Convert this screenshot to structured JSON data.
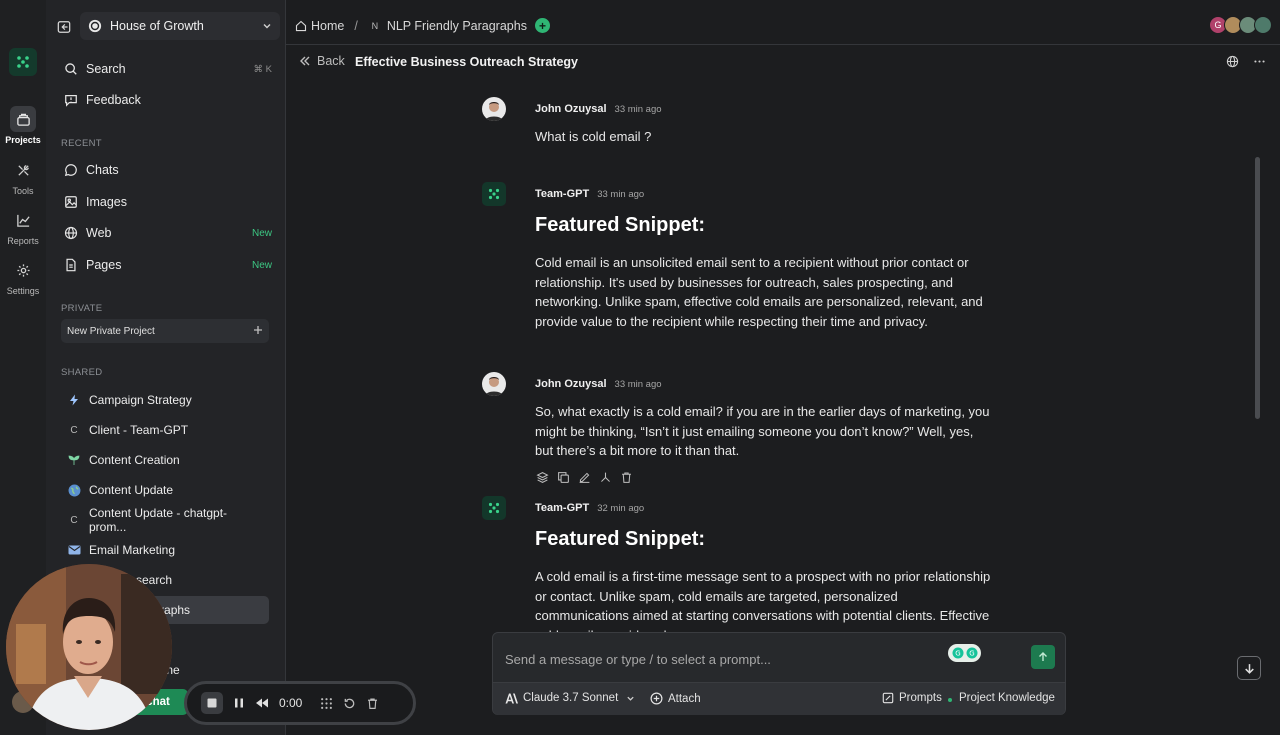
{
  "rail": {
    "items": [
      {
        "label": "Projects",
        "icon": "projects-icon"
      },
      {
        "label": "Tools",
        "icon": "tools-icon"
      },
      {
        "label": "Reports",
        "icon": "reports-icon"
      },
      {
        "label": "Settings",
        "icon": "settings-icon"
      }
    ]
  },
  "workspace": {
    "name": "House of Growth"
  },
  "sidebar": {
    "search": {
      "label": "Search",
      "shortcut": "⌘ K"
    },
    "feedback": {
      "label": "Feedback"
    },
    "recent_header": "RECENT",
    "recent": [
      {
        "label": "Chats",
        "badge": ""
      },
      {
        "label": "Images",
        "badge": ""
      },
      {
        "label": "Web",
        "badge": "New"
      },
      {
        "label": "Pages",
        "badge": "New"
      }
    ],
    "private_header": "PRIVATE",
    "new_private_project": "New Private Project",
    "shared_header": "SHARED",
    "projects": [
      {
        "label": "Campaign Strategy",
        "icon_char": ""
      },
      {
        "label": "Client - Team-GPT",
        "icon_char": "C"
      },
      {
        "label": "Content Creation",
        "icon_char": ""
      },
      {
        "label": "Content Update",
        "icon_char": ""
      },
      {
        "label": "Content Update - chatgpt-prom...",
        "icon_char": "C"
      },
      {
        "label": "Email Marketing",
        "icon_char": ""
      },
      {
        "label": "search",
        "icon_char": ""
      },
      {
        "label": "aragraphs",
        "icon_char": ""
      },
      {
        "label": "r X",
        "icon_char": ""
      },
      {
        "label": "utline",
        "icon_char": ""
      }
    ],
    "new_chat": "chat"
  },
  "topbar": {
    "home": "Home",
    "separator": "/",
    "project_initial": "N",
    "project": "NLP Friendly Paragraphs",
    "avatar_initial": "G"
  },
  "subbar": {
    "back": "Back",
    "title": "Effective Business Outreach Strategy"
  },
  "messages": [
    {
      "author": "John Ozuysal",
      "time": "33 min ago",
      "heading": "",
      "body": "What is cold email ?"
    },
    {
      "author": "Team-GPT",
      "time": "33 min ago",
      "heading": "Featured Snippet:",
      "body": "Cold email is an unsolicited email sent to a recipient without prior contact or relationship. It's used by businesses for outreach, sales prospecting, and networking. Unlike spam, effective cold emails are personalized, relevant, and provide value to the recipient while respecting their time and privacy."
    },
    {
      "author": "John Ozuysal",
      "time": "33 min ago",
      "heading": "",
      "body": "So, what exactly is a cold email? if you are in the earlier days of marketing, you might be thinking, “Isn’t it just emailing someone you don’t know?” Well, yes, but there’s a bit more to it than that."
    },
    {
      "author": "Team-GPT",
      "time": "32 min ago",
      "heading": "Featured Snippet:",
      "body": "A cold email is a first-time message sent to a prospect with no prior relationship or contact. Unlike spam, cold emails are targeted, personalized communications aimed at starting conversations with potential clients. Effective cold emails provide value,"
    }
  ],
  "composer": {
    "placeholder": "Send a message or type / to select a prompt...",
    "model": "Claude 3.7 Sonnet",
    "attach": "Attach",
    "prompts": "Prompts",
    "knowledge": "Project Knowledge"
  },
  "recorder": {
    "time": "0:00"
  },
  "colors": {
    "accent": "#2fb574",
    "background": "#1c1d1f",
    "sidebar": "#232427"
  }
}
